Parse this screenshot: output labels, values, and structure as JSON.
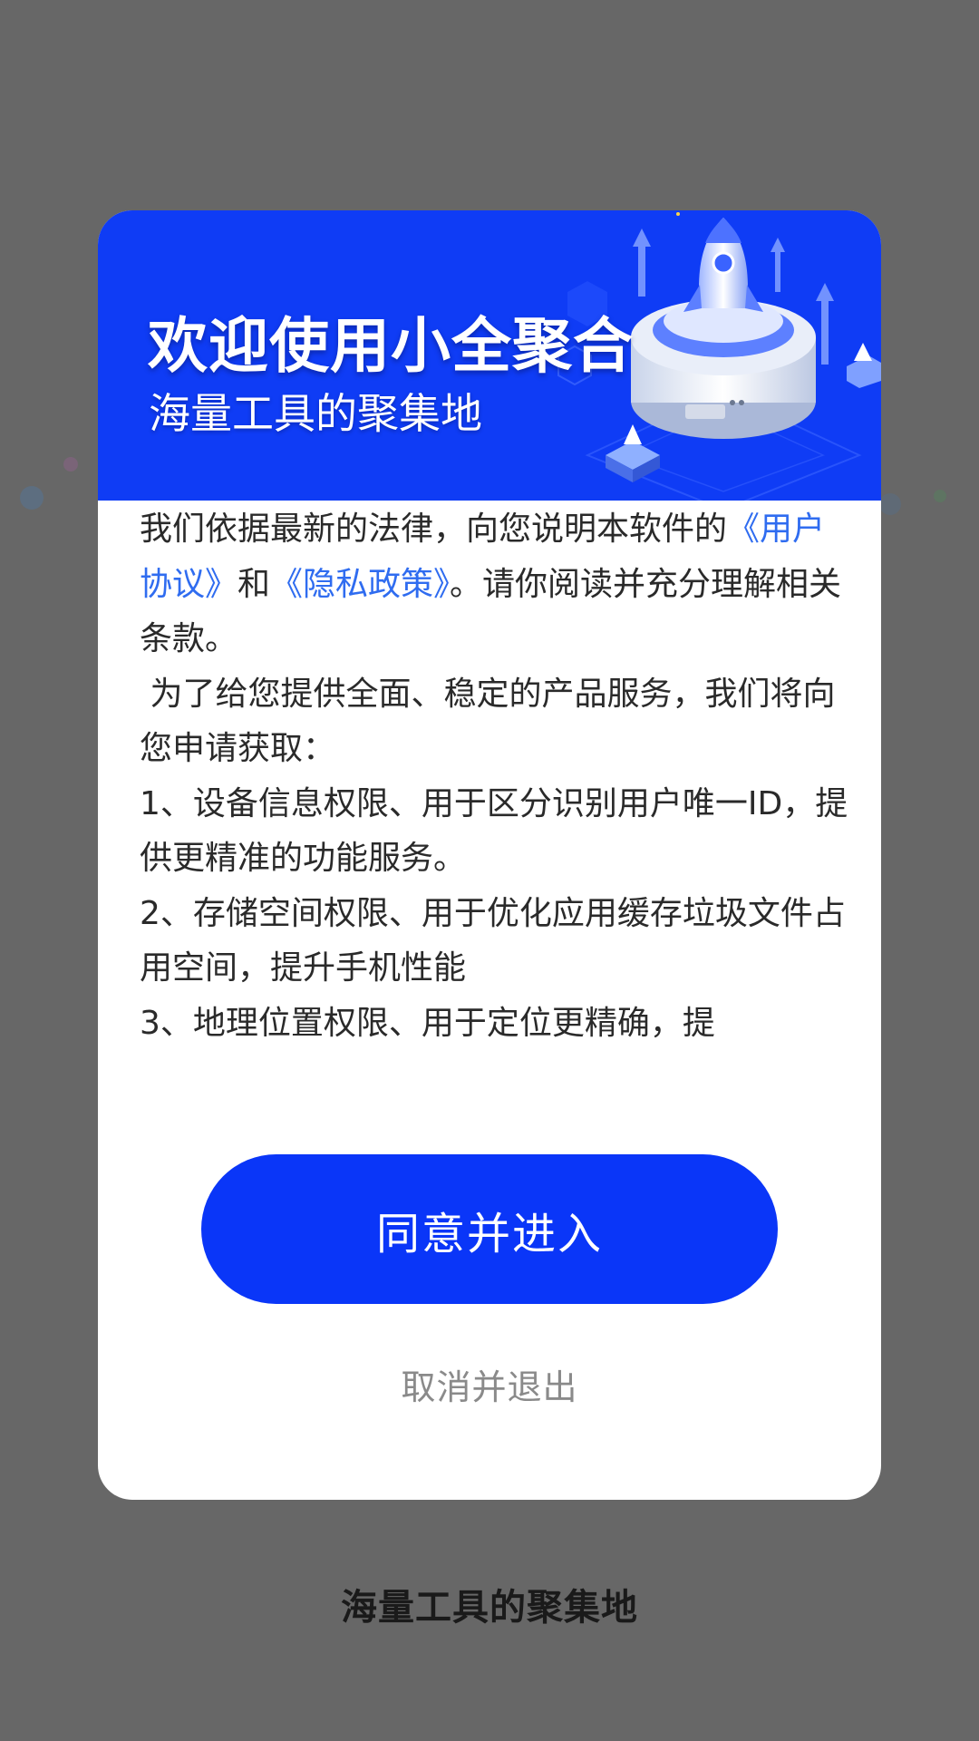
{
  "banner": {
    "title": "欢迎使用小全聚合",
    "subtitle": "海量工具的聚集地",
    "illustration_icon": "rocket-server-icon"
  },
  "content": {
    "intro_before": "我们依据最新的法律，向您说明本软件的",
    "user_agreement_link": "《用户协议》",
    "and_text": "和",
    "privacy_policy_link": "《隐私政策》",
    "intro_after": "。请你阅读并充分理解相关条款。",
    "service_intro": " 为了给您提供全面、稳定的产品服务，我们将向您申请获取：",
    "permissions": [
      "1、设备信息权限、用于区分识别用户唯一ID，提供更精准的功能服务。",
      "2、存储空间权限、用于优化应用缓存垃圾文件占用空间，提升手机性能",
      "3、地理位置权限、用于定位更精确，提"
    ]
  },
  "buttons": {
    "agree_label": "同意并进入",
    "cancel_label": "取消并退出"
  },
  "footer": {
    "tagline": "海量工具的聚集地"
  },
  "colors": {
    "overlay": "#676767",
    "banner_blue": "#0f3cf5",
    "button_blue": "#0a36f8",
    "link_blue": "#2f6cf0"
  }
}
